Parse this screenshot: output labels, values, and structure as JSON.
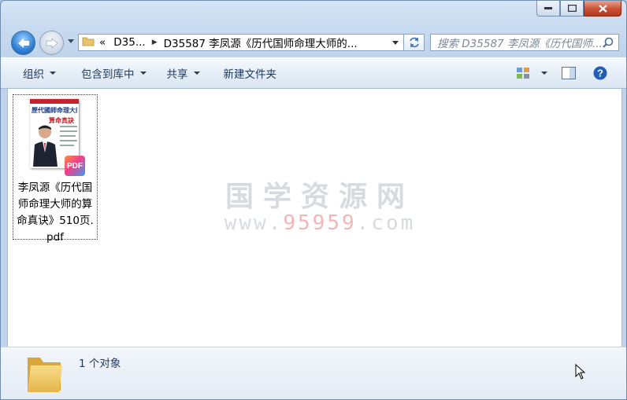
{
  "window": {
    "caption_buttons": [
      "minimize",
      "maximize",
      "close"
    ]
  },
  "nav": {
    "back_icon": "back-arrow-icon",
    "forward_icon": "forward-arrow-icon",
    "overflow": "«",
    "breadcrumb": [
      "D35...",
      "D35587 李凤源《历代国师命理大师的..."
    ],
    "search_placeholder": "搜索 D35587 李凤源《历代国师..."
  },
  "toolbar": {
    "organize": "组织",
    "include_library": "包含到库中",
    "share": "共享",
    "new_folder": "新建文件夹"
  },
  "files": [
    {
      "name": "李凤源《历代国师命理大师的算命真诀》510页.pdf",
      "type_badge": "PDF",
      "cover_title": "歷代國師命理大師",
      "cover_subtitle": "算命真訣"
    }
  ],
  "watermark": {
    "title": "国学资源网",
    "url_prefix": "www.",
    "url_number": "95959",
    "url_suffix": ".com"
  },
  "status": {
    "count_text": "1 个对象"
  },
  "colors": {
    "accent": "#1e395b",
    "watermark_red": "#f3b6b6"
  }
}
